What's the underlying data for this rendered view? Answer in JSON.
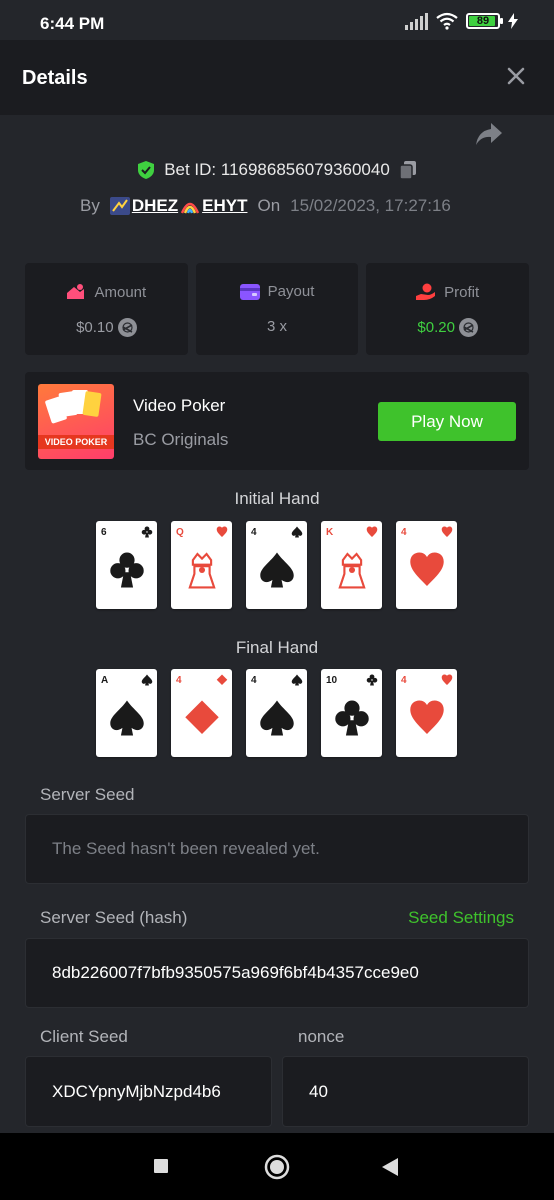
{
  "status": {
    "time": "6:44 PM",
    "battery": "89"
  },
  "header": {
    "title": "Details"
  },
  "bet": {
    "id_label": "Bet ID: 116986856079360040",
    "by": "By",
    "user": "DHEZ",
    "user2": "EHYT",
    "on": "On",
    "date": "15/02/2023, 17:27:16"
  },
  "stats": [
    {
      "label": "Amount",
      "value": "$0.10"
    },
    {
      "label": "Payout",
      "value": "3 x"
    },
    {
      "label": "Profit",
      "value": "$0.20"
    }
  ],
  "game": {
    "name": "Video Poker",
    "provider": "BC Originals",
    "thumb_label": "VIDEO POKER",
    "play": "Play Now"
  },
  "initial_hand": {
    "title": "Initial Hand",
    "cards": [
      {
        "rank": "6",
        "suit": "clubs"
      },
      {
        "rank": "Q",
        "suit": "hearts"
      },
      {
        "rank": "4",
        "suit": "spades"
      },
      {
        "rank": "K",
        "suit": "hearts"
      },
      {
        "rank": "4",
        "suit": "hearts"
      }
    ]
  },
  "final_hand": {
    "title": "Final Hand",
    "cards": [
      {
        "rank": "A",
        "suit": "spades"
      },
      {
        "rank": "4",
        "suit": "diamonds"
      },
      {
        "rank": "4",
        "suit": "spades"
      },
      {
        "rank": "10",
        "suit": "clubs"
      },
      {
        "rank": "4",
        "suit": "hearts"
      }
    ]
  },
  "server_seed": {
    "label": "Server Seed",
    "value": "The Seed hasn't been revealed yet."
  },
  "server_hash": {
    "label": "Server Seed (hash)",
    "settings": "Seed Settings",
    "value": "8db226007f7bfb9350575a969f6bf4b4357cce9e0"
  },
  "client_seed": {
    "label": "Client Seed",
    "value": "XDCYpnyMjbNzpd4b6"
  },
  "nonce": {
    "label": "nonce",
    "value": "40"
  },
  "colors": {
    "green": "#3fc22c",
    "bg": "#24262b",
    "panel": "#1b1c20",
    "red": "#e84a3c"
  }
}
